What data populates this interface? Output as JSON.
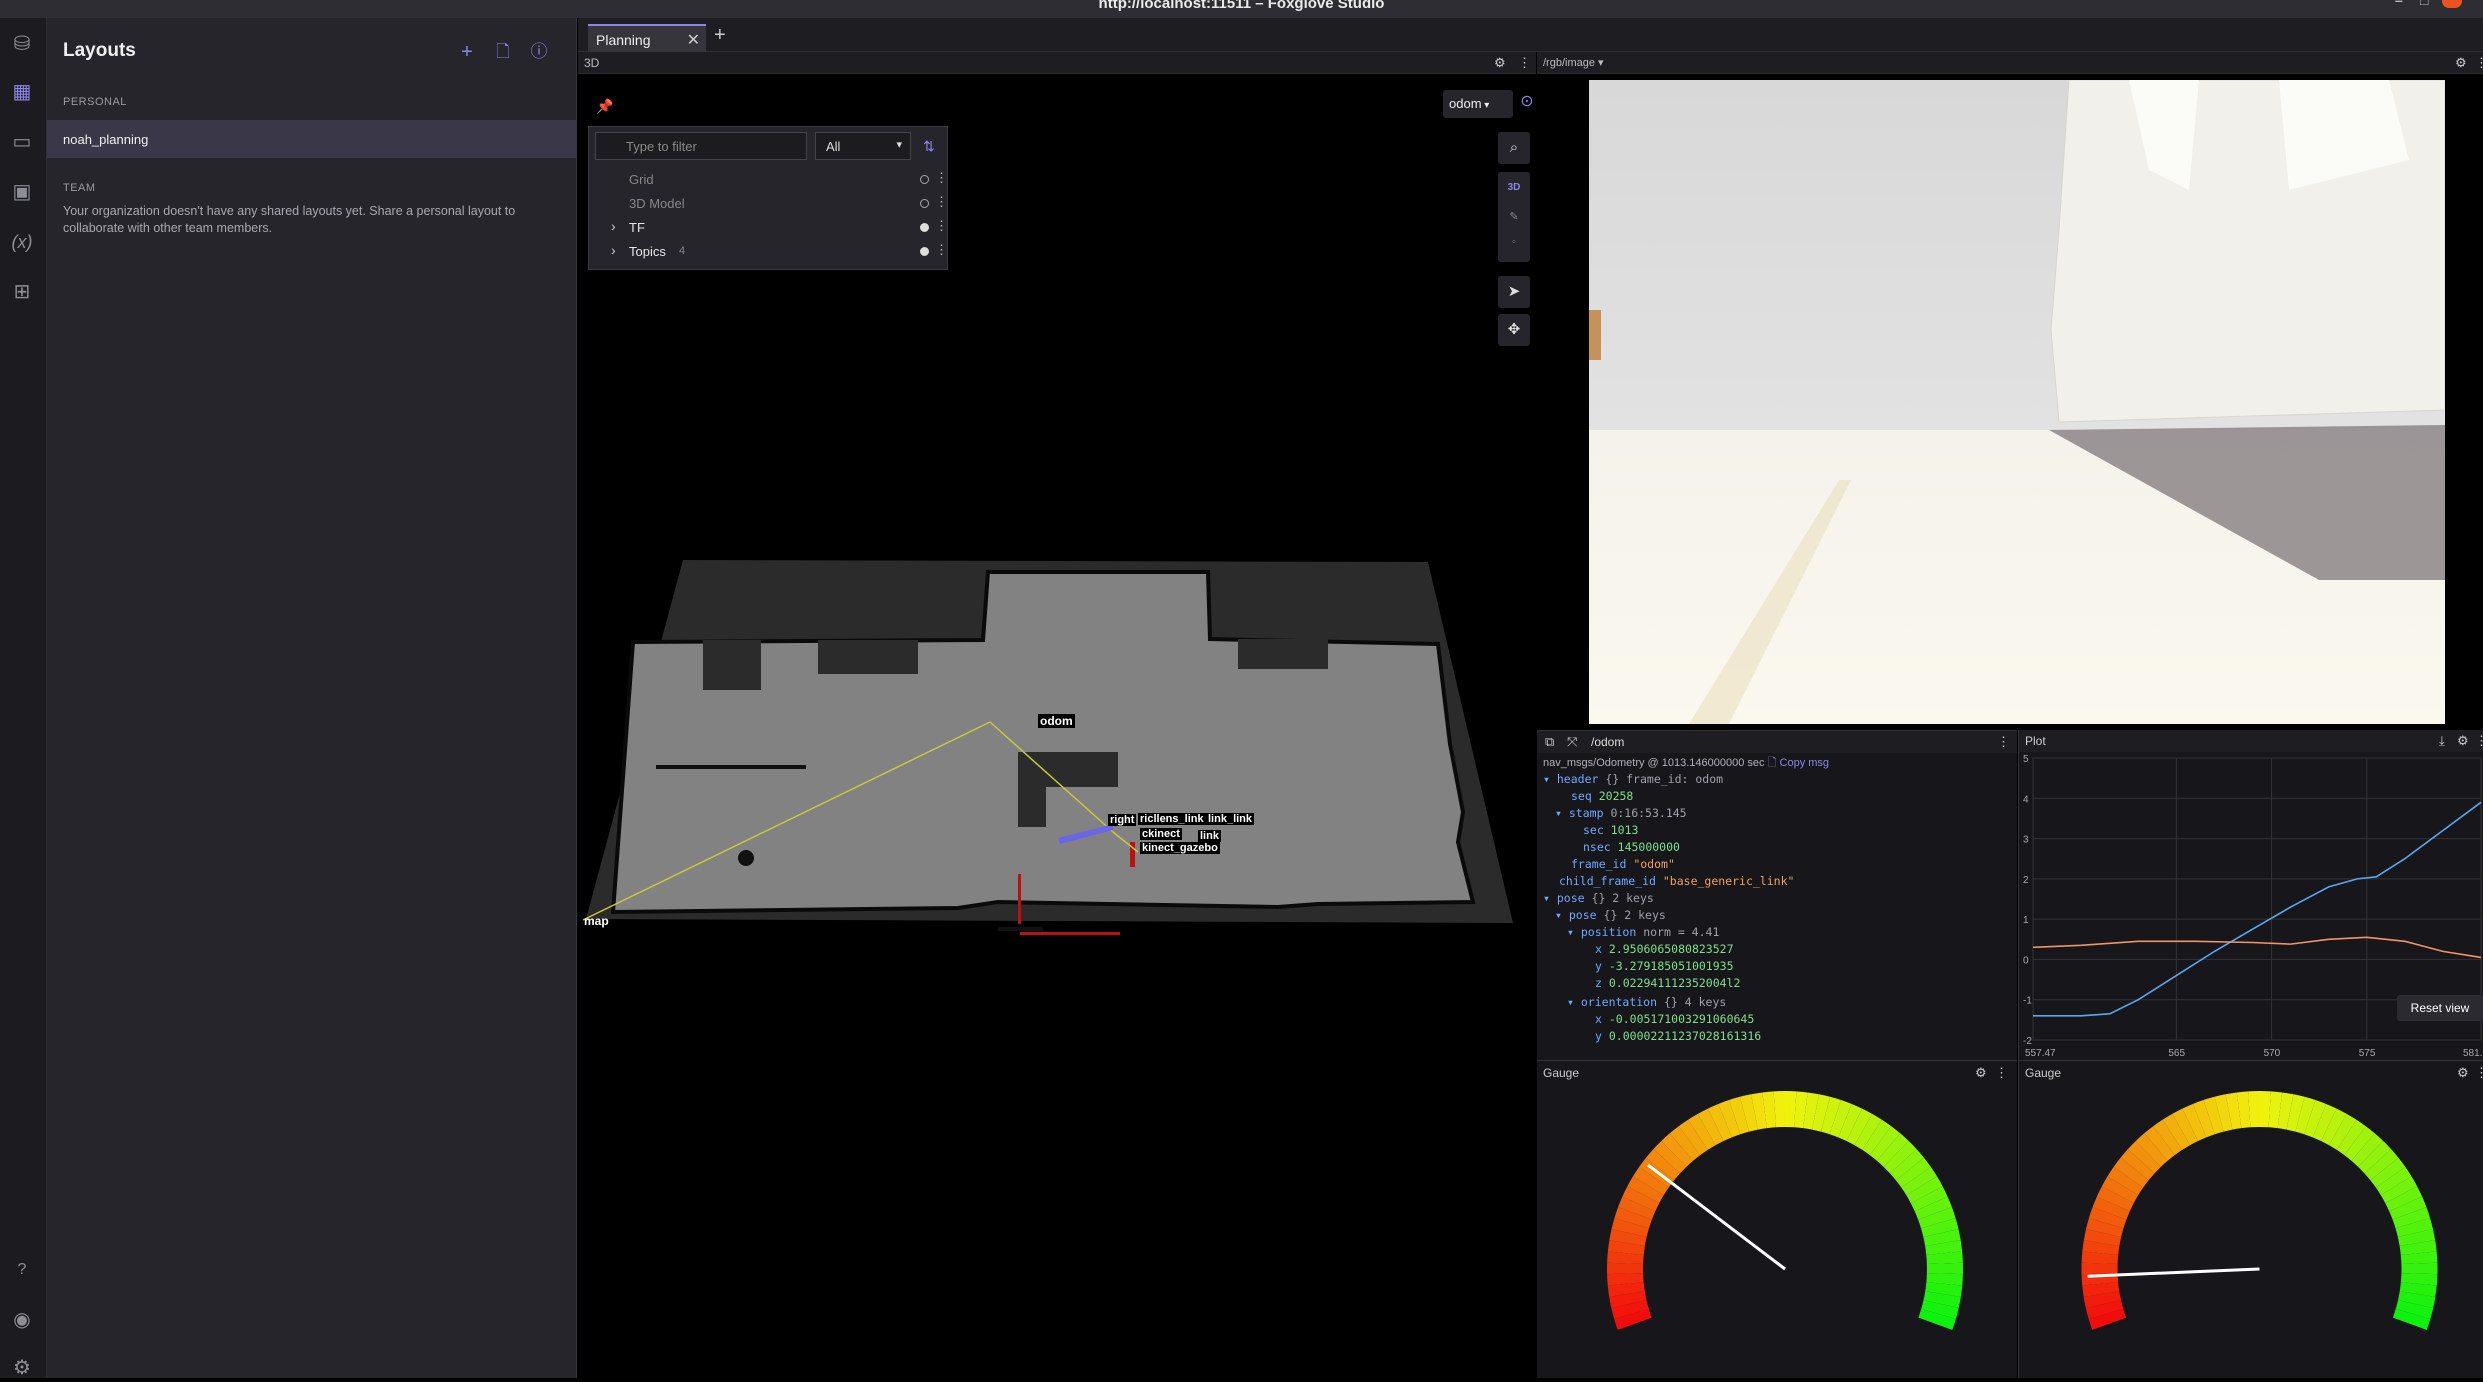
{
  "window": {
    "title": "http://localhost:11511 – Foxglove Studio"
  },
  "sidebar": {
    "title": "Layouts",
    "personal_label": "PERSONAL",
    "selected_layout": "noah_planning",
    "team_label": "TEAM",
    "team_message": "Your organization doesn't have any shared layouts yet. Share a personal layout to collaborate with other team members."
  },
  "tabs": [
    {
      "label": "Planning"
    }
  ],
  "panel_3d": {
    "title": "3D",
    "filter_placeholder": "Type to filter",
    "filter_mode": "All",
    "layers": [
      {
        "name": "Grid"
      },
      {
        "name": "3D Model"
      },
      {
        "name": "TF"
      },
      {
        "name": "Topics",
        "count": "4"
      }
    ],
    "frame": "odom",
    "mode_label": "3D",
    "scene_labels": {
      "odom": "odom",
      "map": "map",
      "l1": "right",
      "l2": "ricllens_link",
      "l3": "link_link",
      "l4": "ckinect",
      "l5": "link",
      "l6": "kinect_gazebo"
    }
  },
  "image_panel": {
    "topic": "/rgb/image"
  },
  "raw_messages": {
    "topic": "/odom",
    "schema": "nav_msgs/Odometry",
    "at": "@",
    "stamp_text": "1013.146000000 sec",
    "copy": "Copy msg",
    "header_key": "header",
    "header_summary": "{} frame_id: odom",
    "seq_key": "seq",
    "seq": "20258",
    "stamp_key": "stamp",
    "stamp": "0:16:53.145",
    "sec_key": "sec",
    "sec": "1013",
    "nsec_key": "nsec",
    "nsec": "145000000",
    "frame_id_key": "frame_id",
    "frame_id": "\"odom\"",
    "child_frame_id_key": "child_frame_id",
    "child_frame_id": "\"base_generic_link\"",
    "pose_key": "pose",
    "pose_summary": "{} 2 keys",
    "pose_inner_key": "pose",
    "pose_inner_summary": "{} 2 keys",
    "position_key": "position",
    "position_summary": "norm = 4.41",
    "pos_x_key": "x",
    "pos_x": "2.9506065080823527",
    "pos_y_key": "y",
    "pos_y": "-3.279185051001935",
    "pos_z_key": "z",
    "pos_z": "0.022941112352004l2",
    "orientation_key": "orientation",
    "orientation_summary": "{} 4 keys",
    "ori_x_key": "x",
    "ori_x": "-0.005171003291060645",
    "ori_y_key": "y",
    "ori_y": "0.00002211237028161316"
  },
  "plot": {
    "title": "Plot",
    "reset_label": "Reset view",
    "chart_data": {
      "type": "line",
      "ylim": [
        -2,
        5
      ],
      "xlim": [
        557.47,
        581
      ],
      "y_ticks": [
        "5",
        "4",
        "3",
        "2",
        "1",
        "0",
        "-1",
        "-2"
      ],
      "x_ticks": [
        "557.47",
        "565",
        "570",
        "575",
        "581."
      ],
      "series": [
        {
          "color": "#5aa7f0",
          "points": [
            [
              557.47,
              -1.4
            ],
            [
              560,
              -1.4
            ],
            [
              561.5,
              -1.35
            ],
            [
              563,
              -1.0
            ],
            [
              565,
              -0.4
            ],
            [
              567,
              0.2
            ],
            [
              569,
              0.75
            ],
            [
              571,
              1.3
            ],
            [
              573,
              1.8
            ],
            [
              574.5,
              2.0
            ],
            [
              575.5,
              2.05
            ],
            [
              577,
              2.5
            ],
            [
              579,
              3.2
            ],
            [
              581,
              3.9
            ]
          ]
        },
        {
          "color": "#f0946a",
          "points": [
            [
              557.47,
              0.3
            ],
            [
              560,
              0.35
            ],
            [
              563,
              0.45
            ],
            [
              566,
              0.45
            ],
            [
              569,
              0.42
            ],
            [
              571,
              0.38
            ],
            [
              573,
              0.5
            ],
            [
              575,
              0.55
            ],
            [
              577,
              0.45
            ],
            [
              579,
              0.2
            ],
            [
              581,
              0.05
            ]
          ]
        }
      ]
    }
  },
  "gauges": [
    {
      "title": "Gauge",
      "fraction": 0.26
    },
    {
      "title": "Gauge",
      "fraction": 0.08
    }
  ]
}
